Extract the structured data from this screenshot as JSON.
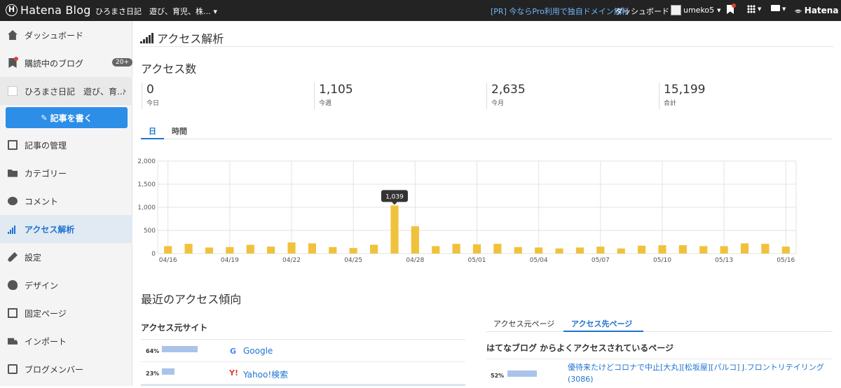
{
  "topbar": {
    "logo_mark": "H",
    "logo_text": "Hatena Blog",
    "blog_selector": "ひろまさ日記　遊び、育児、株...",
    "promo": "[PR] 今ならPro利用で独自ドメイン無料",
    "dashboard": "ダッシュボード",
    "username": "umeko5",
    "hatena_brand": "Hatena",
    "icons": [
      "bookmark-icon",
      "apps-grid-icon",
      "chat-bubble-icon"
    ]
  },
  "sidebar": {
    "dashboard": "ダッシュボード",
    "subscriptions": "購読中のブログ",
    "subscriptions_badge": "20+",
    "blog_name": "ひろまさ日記　遊び、育...",
    "write_button": "記事を書く",
    "items": [
      {
        "label": "記事の管理",
        "icon": "document-icon"
      },
      {
        "label": "カテゴリー",
        "icon": "folder-icon"
      },
      {
        "label": "コメント",
        "icon": "comment-icon"
      },
      {
        "label": "アクセス解析",
        "icon": "bar-chart-icon"
      },
      {
        "label": "設定",
        "icon": "wrench-icon"
      },
      {
        "label": "デザイン",
        "icon": "palette-icon"
      },
      {
        "label": "固定ページ",
        "icon": "page-icon"
      },
      {
        "label": "インポート",
        "icon": "truck-icon"
      },
      {
        "label": "ブログメンバー",
        "icon": "members-icon"
      }
    ]
  },
  "main": {
    "title": "アクセス解析",
    "access_heading": "アクセス数",
    "stats": [
      {
        "value": "0",
        "label": "今日"
      },
      {
        "value": "1,105",
        "label": "今週"
      },
      {
        "value": "2,635",
        "label": "今月"
      },
      {
        "value": "15,199",
        "label": "合計"
      }
    ],
    "tabs": [
      "日",
      "時間"
    ],
    "tooltip": "1,039",
    "trend_heading": "最近のアクセス傾向",
    "referrer_heading": "アクセス元サイト",
    "referrers": [
      {
        "pct": "64%",
        "share": 0.64,
        "name": "Google",
        "icon": "G"
      },
      {
        "pct": "23%",
        "share": 0.23,
        "name": "Yahoo!検索",
        "icon": "Y!"
      }
    ],
    "page_tabs": [
      "アクセス元ページ",
      "アクセス先ページ"
    ],
    "dest_heading": "はてなブログ からよくアクセスされているページ",
    "destinations": [
      {
        "pct": "52%",
        "share": 0.52,
        "title": "優待来たけどコロナで中止[大丸][松坂屋][パルコ] J.フロントリテイリング(3086)"
      }
    ]
  },
  "chart_data": {
    "type": "bar",
    "categories": [
      "04/16",
      "04/17",
      "04/18",
      "04/19",
      "04/20",
      "04/21",
      "04/22",
      "04/23",
      "04/24",
      "04/25",
      "04/26",
      "04/27",
      "04/28",
      "04/29",
      "04/30",
      "05/01",
      "05/02",
      "05/03",
      "05/04",
      "05/05",
      "05/06",
      "05/07",
      "05/08",
      "05/09",
      "05/10",
      "05/11",
      "05/12",
      "05/13",
      "05/14",
      "05/15",
      "05/16"
    ],
    "values": [
      160,
      210,
      130,
      140,
      190,
      150,
      240,
      220,
      140,
      120,
      190,
      1039,
      590,
      160,
      210,
      200,
      210,
      140,
      130,
      110,
      130,
      150,
      110,
      170,
      180,
      180,
      160,
      160,
      220,
      210,
      150
    ],
    "x_tick_labels": [
      "04/16",
      "04/19",
      "04/22",
      "04/25",
      "04/28",
      "05/01",
      "05/04",
      "05/07",
      "05/10",
      "05/13",
      "05/16"
    ],
    "y_ticks": [
      "0",
      "500",
      "1,000",
      "1,500",
      "2,000"
    ],
    "ylim": [
      0,
      2000
    ],
    "grid": true,
    "bar_color": "#f0c13c",
    "highlighted_value": 1039
  }
}
